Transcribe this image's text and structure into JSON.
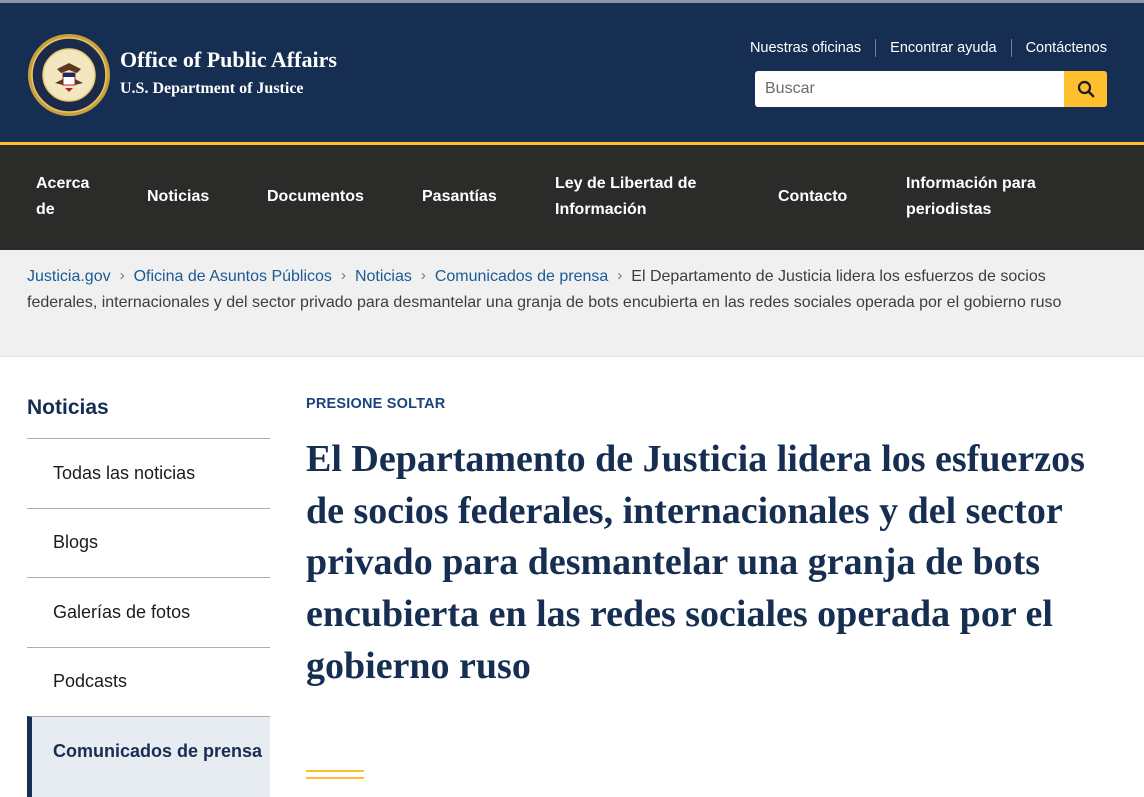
{
  "brand": {
    "title": "Office of Public Affairs",
    "subtitle": "U.S. Department of Justice"
  },
  "utility_nav": [
    "Nuestras oficinas",
    "Encontrar ayuda",
    "Contáctenos"
  ],
  "search": {
    "placeholder": "Buscar"
  },
  "main_nav": [
    "Acerca de",
    "Noticias",
    "Documentos",
    "Pasantías",
    "Ley de Libertad de Información",
    "Contacto",
    "Información para periodistas"
  ],
  "breadcrumb": {
    "links": [
      "Justicia.gov",
      "Oficina de Asuntos Públicos",
      "Noticias",
      "Comunicados de prensa"
    ],
    "current": "El Departamento de Justicia lidera los esfuerzos de socios federales, internacionales y del sector privado para desmantelar una granja de bots encubierta en las redes sociales operada por el gobierno ruso"
  },
  "sidebar": {
    "title": "Noticias",
    "items": [
      {
        "label": "Todas las noticias"
      },
      {
        "label": "Blogs"
      },
      {
        "label": "Galerías de fotos"
      },
      {
        "label": "Podcasts"
      },
      {
        "label": "Comunicados de prensa",
        "active": true
      }
    ]
  },
  "article": {
    "kicker": "PRESIONE SOLTAR",
    "headline": "El Departamento de Justicia lidera los esfuerzos de socios federales, internacionales y del sector privado para desmantelar una granja de bots encubierta en las redes sociales operada por el gobierno ruso"
  },
  "colors": {
    "header_bg": "#162e51",
    "nav_bg": "#2b2b29",
    "accent": "#ffbe2e",
    "link": "#1a5a96"
  },
  "icons": {
    "seal": "doj-seal-icon",
    "search": "search-icon",
    "chevron": "chevron-right-icon"
  }
}
